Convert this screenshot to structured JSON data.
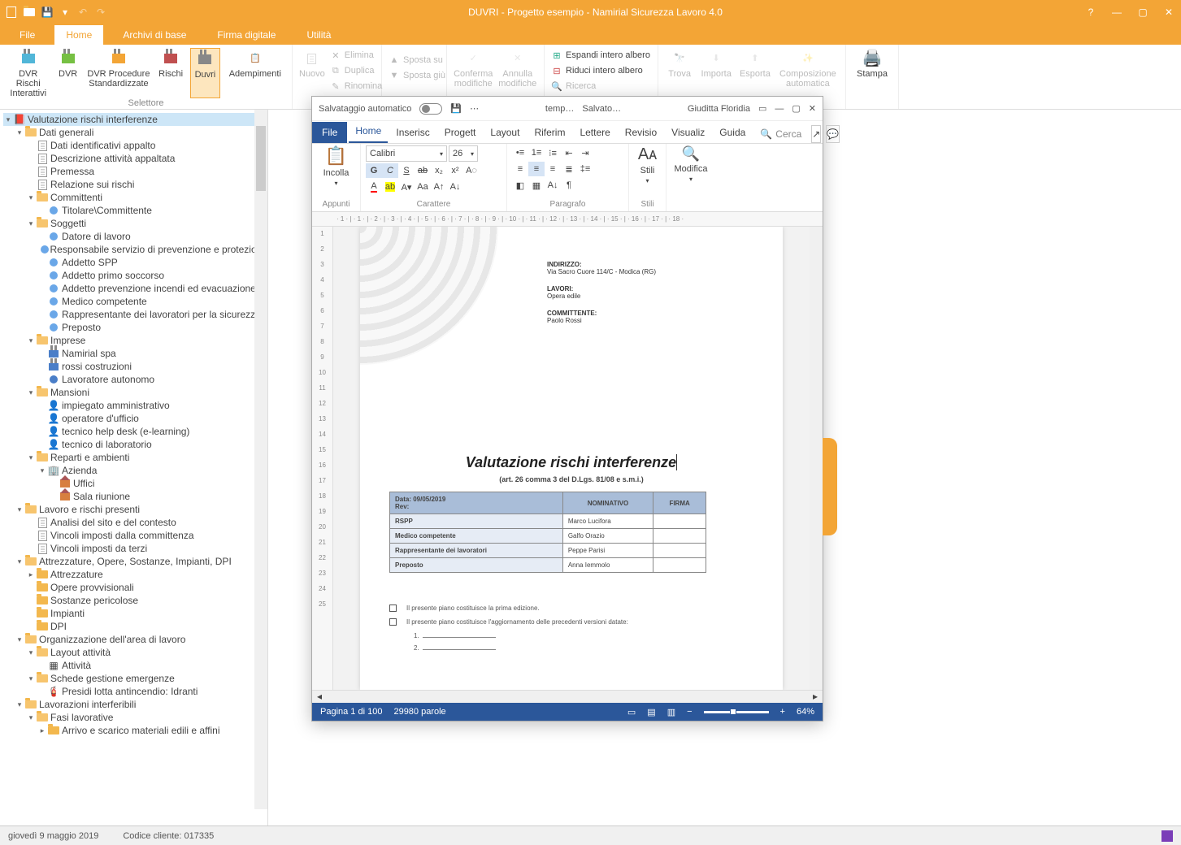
{
  "app": {
    "title": "DUVRI - Progetto esempio - Namirial Sicurezza Lavoro 4.0",
    "help": "?",
    "menus": {
      "file": "File",
      "home": "Home",
      "archivi": "Archivi di base",
      "firma": "Firma digitale",
      "utilita": "Utilità"
    },
    "status": {
      "date": "giovedì 9 maggio 2019",
      "codice": "Codice cliente: 017335"
    }
  },
  "ribbon": {
    "selettore": "Selettore",
    "dvrri": "DVR Rischi\nInterattivi",
    "dvr": "DVR",
    "dvrps": "DVR Procedure\nStandardizzate",
    "rischi": "Rischi",
    "duvri": "Duvri",
    "ademp": "Adempimenti",
    "nuovo": "Nuovo",
    "elimina": "Elimina",
    "duplica": "Duplica",
    "rinomina": "Rinomina",
    "spostasu": "Sposta su",
    "spostagiu": "Sposta giù",
    "conferma": "Conferma\nmodifiche",
    "annulla": "Annulla\nmodifiche",
    "espandi": "Espandi intero albero",
    "riduci": "Riduci intero albero",
    "ricerca": "Ricerca",
    "trova": "Trova",
    "importa": "Importa",
    "esporta": "Esporta",
    "compo": "Composizione\nautomatica",
    "stampa": "Stampa"
  },
  "tree": {
    "root": "Valutazione rischi interferenze",
    "datigen": "Dati generali",
    "dia": "Dati identificativi appalto",
    "daa": "Descrizione attività appaltata",
    "prem": "Premessa",
    "rel": "Relazione sui rischi",
    "committenti": "Committenti",
    "titolare": "Titolare\\Committente",
    "soggetti": "Soggetti",
    "datore": "Datore di lavoro",
    "rspp": "Responsabile servizio di prevenzione e protezione",
    "spp": "Addetto SPP",
    "aps": "Addetto primo soccorso",
    "apie": "Addetto prevenzione incendi ed evacuazione",
    "medico": "Medico competente",
    "rls": "Rappresentante dei lavoratori per la sicurezza",
    "preposto": "Preposto",
    "imprese": "Imprese",
    "imp1": "Namirial spa",
    "imp2": "rossi costruzioni",
    "imp3": "Lavoratore autonomo",
    "mansioni": "Mansioni",
    "m1": "impiegato amministrativo",
    "m2": "operatore d'ufficio",
    "m3": "tecnico help desk (e-learning)",
    "m4": "tecnico di laboratorio",
    "reparti": "Reparti e ambienti",
    "azienda": "Azienda",
    "uffici": "Uffici",
    "sala": "Sala riunione",
    "lavoro": "Lavoro e rischi presenti",
    "l1": "Analisi del sito e del contesto",
    "l2": "Vincoli imposti dalla committenza",
    "l3": "Vincoli imposti da terzi",
    "attrezz": "Attrezzature, Opere, Sostanze, Impianti, DPI",
    "a1": "Attrezzature",
    "a2": "Opere provvisionali",
    "a3": "Sostanze pericolose",
    "a4": "Impianti",
    "a5": "DPI",
    "org": "Organizzazione dell'area di lavoro",
    "layout": "Layout attività",
    "attivita": "Attività",
    "schede": "Schede gestione emergenze",
    "presidi": "Presidi lotta antincendio: Idranti",
    "lavint": "Lavorazioni interferibili",
    "fasi": "Fasi lavorative",
    "arrivo": "Arrivo e scarico materiali edili e affini"
  },
  "word": {
    "autosave": "Salvataggio automatico",
    "fname": "temp…",
    "state": "Salvato…",
    "user": "Giuditta Floridia",
    "tabs": {
      "file": "File",
      "home": "Home",
      "inserisci": "Inserisc",
      "progett": "Progett",
      "layout": "Layout",
      "riferim": "Riferim",
      "lettere": "Lettere",
      "revisio": "Revisio",
      "visualiz": "Visualiz",
      "guida": "Guida"
    },
    "search": "Cerca",
    "groups": {
      "appunti": "Appunti",
      "incolla": "Incolla",
      "carattere": "Carattere",
      "paragrafo": "Paragrafo",
      "stili": "Stili",
      "modifica": "Modifica"
    },
    "font": "Calibri",
    "fontsize": "26",
    "doc": {
      "ind_h": "INDIRIZZO:",
      "ind": "Via Sacro Cuore 114/C - Modica (RG)",
      "lav_h": "LAVORI:",
      "lav": "Opera edile",
      "com_h": "COMMITTENTE:",
      "com": "Paolo Rossi",
      "title": "Valutazione rischi interferenze",
      "sub": "(art. 26 comma 3 del D.Lgs. 81/08 e s.m.i.)",
      "header_date": "Data: 09/05/2019",
      "header_rev": "Rev:",
      "col_nom": "NOMINATIVO",
      "col_firma": "FIRMA",
      "r1": "RSPP",
      "r1n": "Marco Lucifora",
      "r2": "Medico competente",
      "r2n": "Galfo Orazio",
      "r3": "Rappresentante dei lavoratori",
      "r3n": "Peppe Parisi",
      "r4": "Preposto",
      "r4n": "Anna Iemmolo",
      "note1": "Il presente piano costituisce la prima edizione.",
      "note2": "Il presente piano costituisce l'aggiornamento delle precedenti versioni datate:",
      "n1": "1.",
      "n2": "2."
    },
    "status": {
      "page": "Pagina 1 di 100",
      "words": "29980 parole",
      "zoom": "64%"
    }
  }
}
